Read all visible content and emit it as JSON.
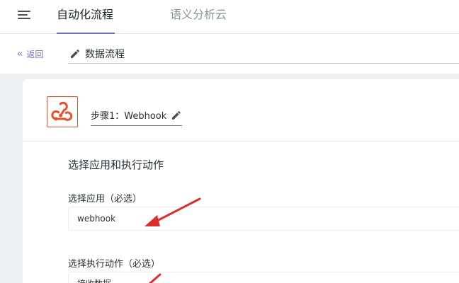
{
  "topbar": {
    "tabs": [
      {
        "label": "自动化流程",
        "active": true
      },
      {
        "label": "语义分析云",
        "active": false
      }
    ]
  },
  "subheader": {
    "back_label": "返回",
    "back_icon": "double-chevron-left",
    "flow_title": "数据流程"
  },
  "step": {
    "title": "步骤1：Webhook",
    "app_icon": "webhook-icon",
    "section_title": "选择应用和执行动作",
    "fields": [
      {
        "label": "选择应用（必选）",
        "value": "webhook"
      },
      {
        "label": "选择执行动作（必选）",
        "value": "接收数据"
      }
    ]
  },
  "colors": {
    "accent": "#6b73c4",
    "webhook_orange": "#e9512c",
    "annotation_red": "#d9302c",
    "canvas_bg": "#eef0f2"
  }
}
